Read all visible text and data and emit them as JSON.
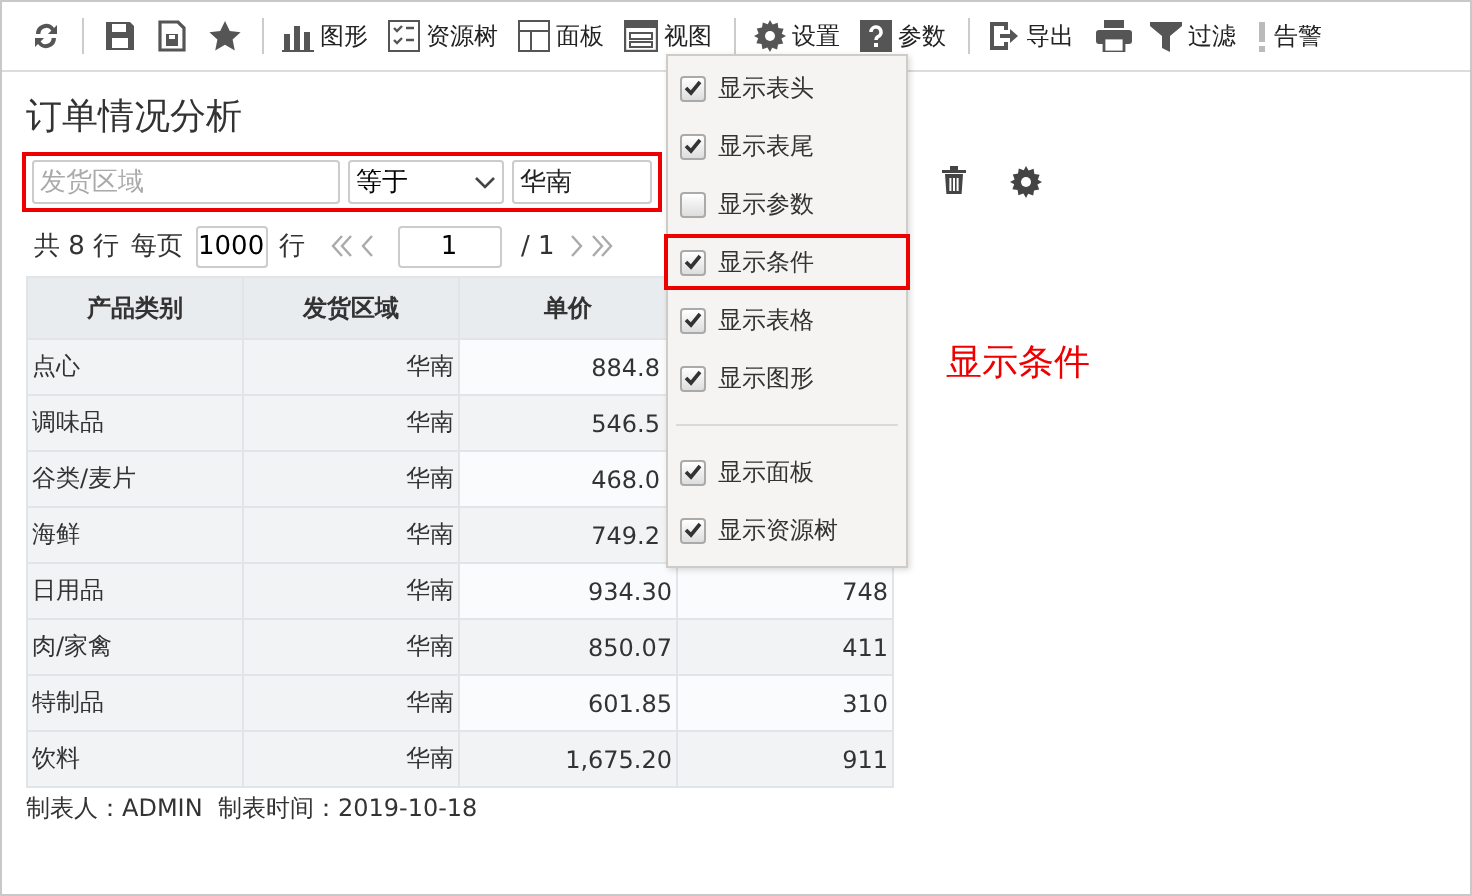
{
  "toolbar": {
    "items": [
      {
        "kind": "icon"
      },
      {
        "kind": "separator"
      },
      {
        "kind": "icon"
      },
      {
        "kind": "icon"
      },
      {
        "kind": "icon"
      },
      {
        "kind": "separator"
      },
      {
        "kind": "labeled",
        "label": "图形"
      },
      {
        "kind": "labeled",
        "label": "资源树"
      },
      {
        "kind": "labeled",
        "label": "面板"
      },
      {
        "kind": "labeled",
        "label": "视图"
      },
      {
        "kind": "separator"
      },
      {
        "kind": "labeled",
        "label": "设置"
      },
      {
        "kind": "labeled",
        "label": "参数"
      },
      {
        "kind": "separator"
      },
      {
        "kind": "labeled",
        "label": "导出"
      },
      {
        "kind": "icon"
      },
      {
        "kind": "labeled",
        "label": "过滤"
      },
      {
        "kind": "labeled",
        "label": "告警"
      }
    ]
  },
  "report": {
    "title": "订单情况分析",
    "condition": {
      "highlighted": true,
      "field": {
        "placeholder": "发货区域"
      },
      "operator": "等于",
      "value": "华南"
    },
    "pager": {
      "total": "共 8 行",
      "per_page_label": "每页",
      "per_page": "1000",
      "rows_label": "行",
      "page": "1",
      "pages": "/ 1"
    },
    "table": {
      "columns": [
        "产品类别",
        "发货区域",
        "单价"
      ],
      "rows": [
        {
          "cells": [
            "点心",
            "华南",
            "884.8"
          ]
        },
        {
          "cells": [
            "调味品",
            "华南",
            "546.5"
          ]
        },
        {
          "cells": [
            "谷类/麦片",
            "华南",
            "468.0"
          ]
        },
        {
          "cells": [
            "海鲜",
            "华南",
            "749.2"
          ]
        },
        {
          "cells": [
            "日用品",
            "华南",
            "934.30",
            "748"
          ]
        },
        {
          "cells": [
            "肉/家禽",
            "华南",
            "850.07",
            "411"
          ]
        },
        {
          "cells": [
            "特制品",
            "华南",
            "601.85",
            "310"
          ]
        },
        {
          "cells": [
            "饮料",
            "华南",
            "1,675.20",
            "911"
          ]
        }
      ]
    },
    "footer": "制表人：ADMIN  制表时间：2019-10-18"
  },
  "view_menu": {
    "items": [
      {
        "kind": "option",
        "label": "显示表头",
        "checked": true,
        "highlighted": false
      },
      {
        "kind": "option",
        "label": "显示表尾",
        "checked": true,
        "highlighted": false
      },
      {
        "kind": "option",
        "label": "显示参数",
        "checked": false,
        "highlighted": false
      },
      {
        "kind": "option",
        "label": "显示条件",
        "checked": true,
        "highlighted": true
      },
      {
        "kind": "option",
        "label": "显示表格",
        "checked": true,
        "highlighted": false
      },
      {
        "kind": "option",
        "label": "显示图形",
        "checked": true,
        "highlighted": false
      },
      {
        "kind": "separator"
      },
      {
        "kind": "option",
        "label": "显示面板",
        "checked": true,
        "highlighted": false
      },
      {
        "kind": "option",
        "label": "显示资源树",
        "checked": true,
        "highlighted": false
      }
    ]
  },
  "callout": "显示条件"
}
